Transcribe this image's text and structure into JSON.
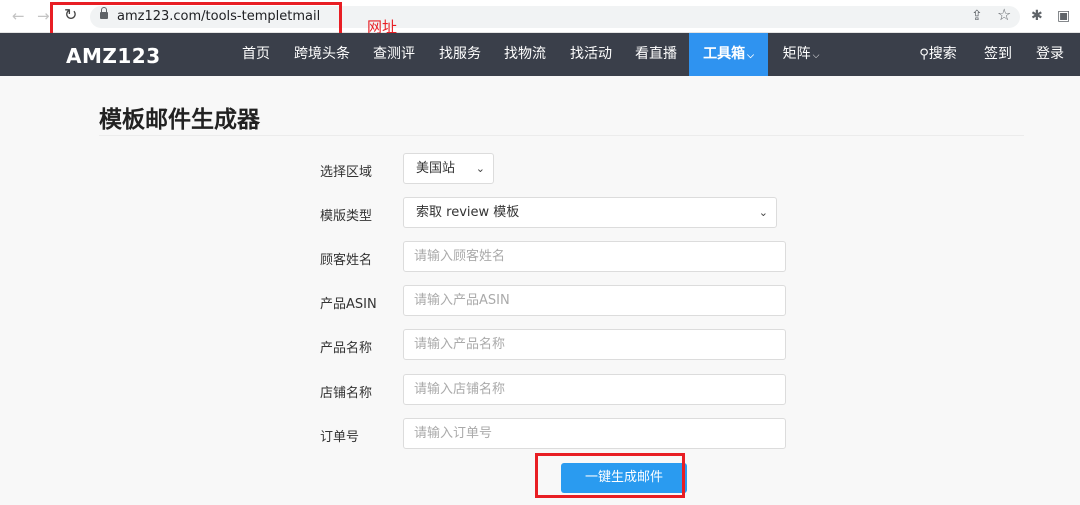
{
  "browser": {
    "url": "amz123.com/tools-templetmail",
    "annotation": "网址",
    "back_icon": "←",
    "forward_icon": "→",
    "reload_icon": "↻",
    "share_icon": "⇪",
    "star_icon": "☆",
    "extensions_icon": "✱",
    "sidepanel_icon": "▣"
  },
  "site": {
    "logo": "AMZ123",
    "nav": [
      {
        "label": "首页"
      },
      {
        "label": "跨境头条"
      },
      {
        "label": "查测评"
      },
      {
        "label": "找服务"
      },
      {
        "label": "找物流"
      },
      {
        "label": "找活动"
      },
      {
        "label": "看直播"
      },
      {
        "label": "工具箱",
        "active": true
      },
      {
        "label": "矩阵"
      }
    ],
    "caret": "⌵",
    "search_label": "搜索",
    "search_icon": "⚲",
    "checkin_label": "签到",
    "login_label": "登录"
  },
  "page": {
    "title": "模板邮件生成器"
  },
  "form": {
    "region": {
      "label": "选择区域",
      "value": "美国站"
    },
    "template": {
      "label": "模版类型",
      "value": "索取 review 模板"
    },
    "customer": {
      "label": "顾客姓名",
      "placeholder": "请输入顾客姓名"
    },
    "asin": {
      "label": "产品ASIN",
      "placeholder": "请输入产品ASIN"
    },
    "product": {
      "label": "产品名称",
      "placeholder": "请输入产品名称"
    },
    "store": {
      "label": "店铺名称",
      "placeholder": "请输入店铺名称"
    },
    "order": {
      "label": "订单号",
      "placeholder": "请输入订单号"
    },
    "submit_label": "一键生成邮件",
    "chevron": "⌄"
  },
  "colors": {
    "navbar_bg": "#3a3f4a",
    "accent": "#2f93f0",
    "annotation_red": "#e81e24"
  }
}
